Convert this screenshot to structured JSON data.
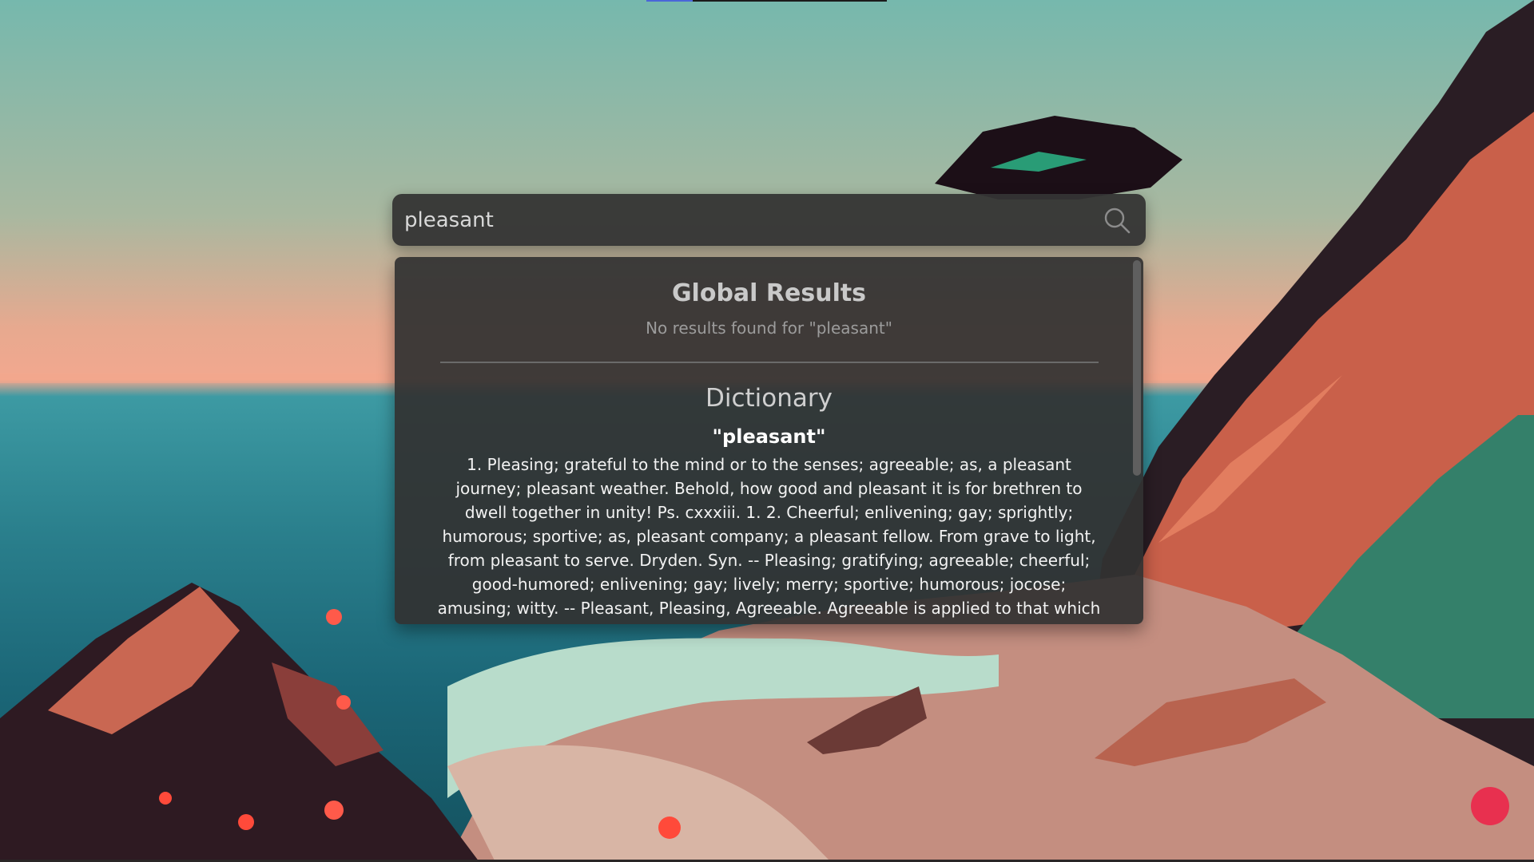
{
  "search": {
    "value": "pleasant",
    "icon": "search-icon"
  },
  "results": {
    "global": {
      "title": "Global Results",
      "message": "No results found for \"pleasant\""
    },
    "dictionary": {
      "title": "Dictionary",
      "term": "\"pleasant\"",
      "definition": "1. Pleasing; grateful to the mind or to the senses; agreeable; as, a pleasant journey; pleasant weather. Behold, how good and pleasant it is for brethren to dwell together in unity! Ps. cxxxiii. 1. 2. Cheerful; enlivening; gay; sprightly; humorous; sportive; as, pleasant company; a pleasant fellow. From grave to light, from pleasant to serve. Dryden. Syn. -- Pleasing; gratifying; agreeable; cheerful; good-humored; enlivening; gay; lively; merry; sportive; humorous; jocose; amusing; witty. -- Pleasant, Pleasing, Agreeable. Agreeable is applied to that which agrees"
    }
  },
  "colors": {
    "panel": "#323232",
    "accent": "#4a66d9"
  }
}
